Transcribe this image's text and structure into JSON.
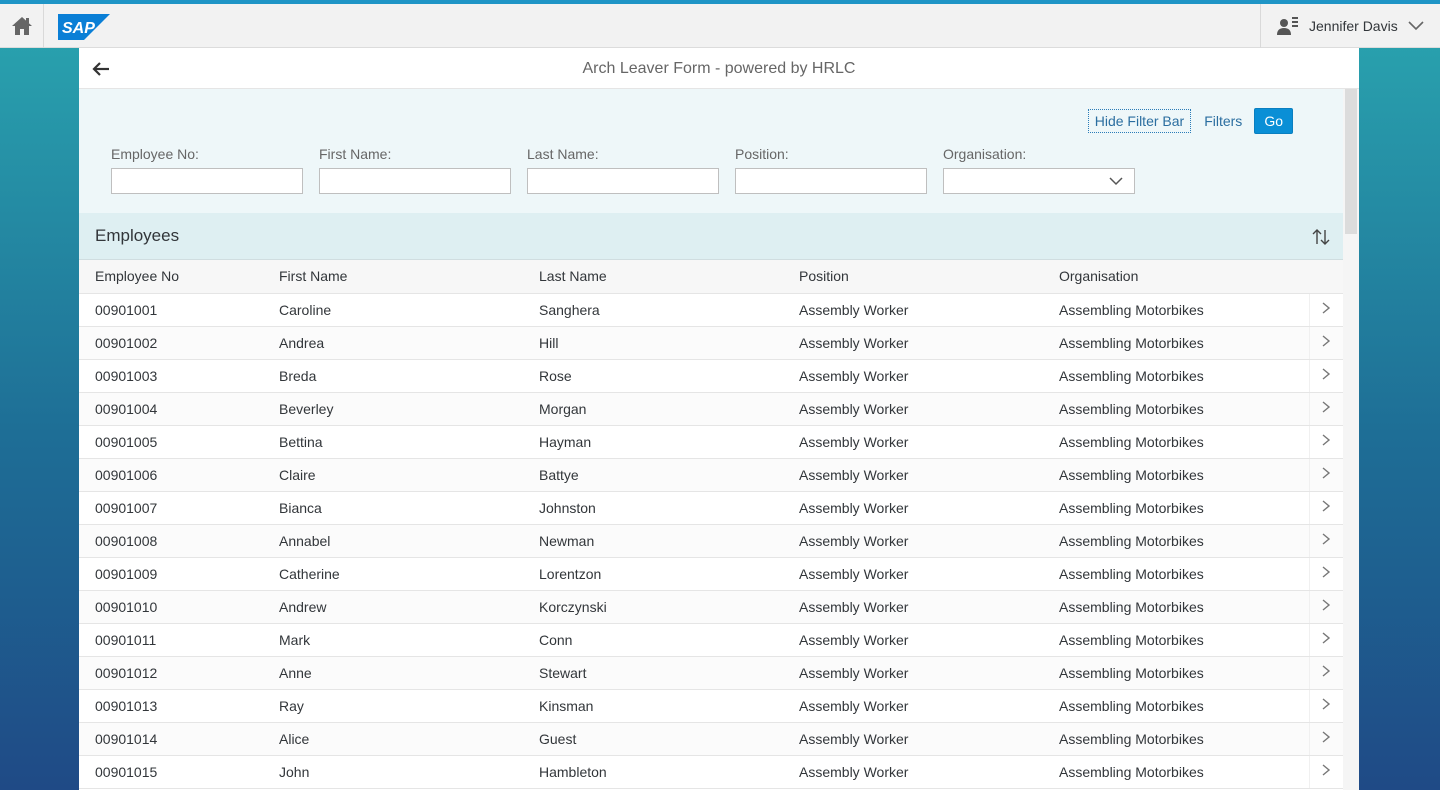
{
  "shell": {
    "logo_text": "SAP",
    "user_name": "Jennifer Davis",
    "icons": {
      "home": "home-icon",
      "user": "user-icon",
      "dropdown": "chevron-down-icon"
    },
    "colors": {
      "accent": "#1f95c6",
      "logo_blue": "#0a7fd6"
    }
  },
  "app": {
    "title": "Arch Leaver Form - powered by HRLC"
  },
  "filter_bar": {
    "hide_label": "Hide Filter Bar",
    "filters_label": "Filters",
    "go_label": "Go",
    "fields": [
      {
        "label": "Employee No:",
        "value": ""
      },
      {
        "label": "First Name:",
        "value": ""
      },
      {
        "label": "Last Name:",
        "value": ""
      },
      {
        "label": "Position:",
        "value": ""
      },
      {
        "label": "Organisation:",
        "value": ""
      }
    ]
  },
  "table": {
    "title": "Employees",
    "columns": [
      "Employee No",
      "First Name",
      "Last Name",
      "Position",
      "Organisation"
    ],
    "rows": [
      [
        "00901001",
        "Caroline",
        "Sanghera",
        "Assembly Worker",
        "Assembling Motorbikes"
      ],
      [
        "00901002",
        "Andrea",
        "Hill",
        "Assembly Worker",
        "Assembling Motorbikes"
      ],
      [
        "00901003",
        "Breda",
        "Rose",
        "Assembly Worker",
        "Assembling Motorbikes"
      ],
      [
        "00901004",
        "Beverley",
        "Morgan",
        "Assembly Worker",
        "Assembling Motorbikes"
      ],
      [
        "00901005",
        "Bettina",
        "Hayman",
        "Assembly Worker",
        "Assembling Motorbikes"
      ],
      [
        "00901006",
        "Claire",
        "Battye",
        "Assembly Worker",
        "Assembling Motorbikes"
      ],
      [
        "00901007",
        "Bianca",
        "Johnston",
        "Assembly Worker",
        "Assembling Motorbikes"
      ],
      [
        "00901008",
        "Annabel",
        "Newman",
        "Assembly Worker",
        "Assembling Motorbikes"
      ],
      [
        "00901009",
        "Catherine",
        "Lorentzon",
        "Assembly Worker",
        "Assembling Motorbikes"
      ],
      [
        "00901010",
        "Andrew",
        "Korczynski",
        "Assembly Worker",
        "Assembling Motorbikes"
      ],
      [
        "00901011",
        "Mark",
        "Conn",
        "Assembly Worker",
        "Assembling Motorbikes"
      ],
      [
        "00901012",
        "Anne",
        "Stewart",
        "Assembly Worker",
        "Assembling Motorbikes"
      ],
      [
        "00901013",
        "Ray",
        "Kinsman",
        "Assembly Worker",
        "Assembling Motorbikes"
      ],
      [
        "00901014",
        "Alice",
        "Guest",
        "Assembly Worker",
        "Assembling Motorbikes"
      ],
      [
        "00901015",
        "John",
        "Hambleton",
        "Assembly Worker",
        "Assembling Motorbikes"
      ]
    ]
  }
}
